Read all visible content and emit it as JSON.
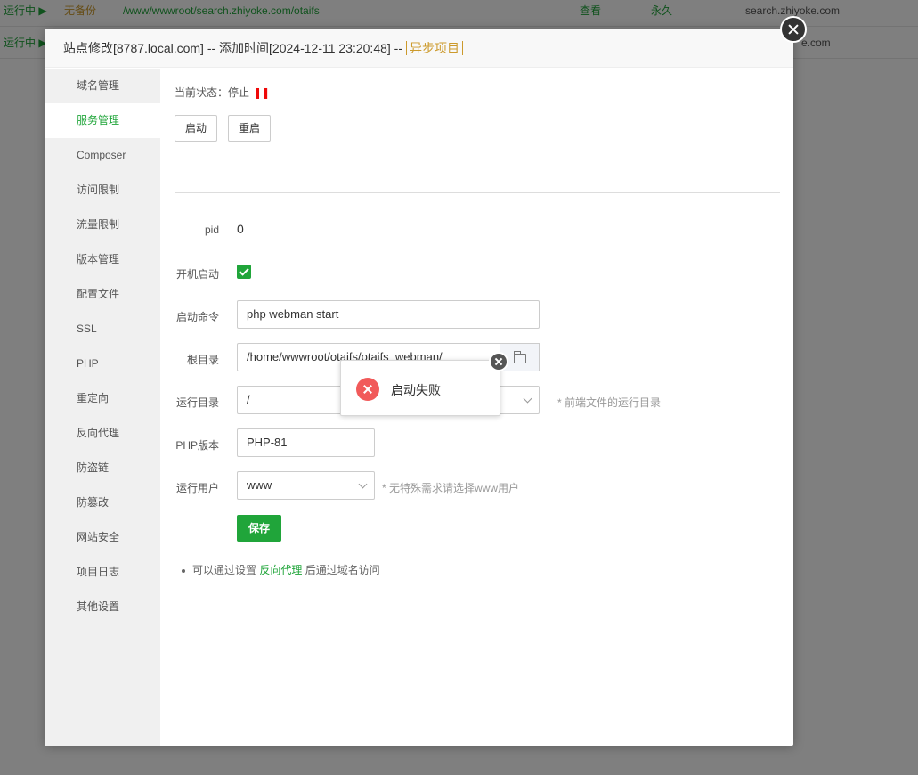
{
  "background_rows": [
    {
      "status": "运行中 ▶",
      "backup": "无备份",
      "path": "/www/wwwroot/search.zhiyoke.com/otaifs",
      "view": "查看",
      "expire": "永久",
      "domain": "search.zhiyoke.com"
    },
    {
      "status": "运行中 ▶",
      "domain": "e.com"
    }
  ],
  "modal": {
    "title": "站点修改[8787.local.com] -- 添加时间[2024-12-11 23:20:48] --",
    "async_tag": "异步项目"
  },
  "sidebar": {
    "items": [
      {
        "label": "域名管理"
      },
      {
        "label": "服务管理"
      },
      {
        "label": "Composer"
      },
      {
        "label": "访问限制"
      },
      {
        "label": "流量限制"
      },
      {
        "label": "版本管理"
      },
      {
        "label": "配置文件"
      },
      {
        "label": "SSL"
      },
      {
        "label": "PHP"
      },
      {
        "label": "重定向"
      },
      {
        "label": "反向代理"
      },
      {
        "label": "防盗链"
      },
      {
        "label": "防篡改"
      },
      {
        "label": "网站安全"
      },
      {
        "label": "项目日志"
      },
      {
        "label": "其他设置"
      }
    ],
    "active": "服务管理"
  },
  "service": {
    "status_label": "当前状态：",
    "status_value": "停止",
    "status_icon": "pause-icon",
    "start_label": "启动",
    "restart_label": "重启"
  },
  "form": {
    "pid_label": "pid",
    "pid_value": "0",
    "autostart_label": "开机启动",
    "autostart_checked": true,
    "command_label": "启动命令",
    "command_value": "php webman start",
    "root_label": "根目录",
    "root_value": "/home/wwwroot/otaifs/otaifs_webman/",
    "rundir_label": "运行目录",
    "rundir_value": "/",
    "rundir_hint": "* 前端文件的运行目录",
    "php_label": "PHP版本",
    "php_value": "PHP-81",
    "user_label": "运行用户",
    "user_value": "www",
    "user_hint": "* 无特殊需求请选择www用户",
    "save_label": "保存"
  },
  "tip": {
    "prefix": "可以通过设置",
    "link": "反向代理",
    "suffix": "后通过域名访问"
  },
  "toast": {
    "message": "启动失败",
    "icon": "error-icon"
  },
  "colors": {
    "accent": "#20a53a",
    "warning": "#cc9a2c",
    "error": "#f15a5a"
  }
}
